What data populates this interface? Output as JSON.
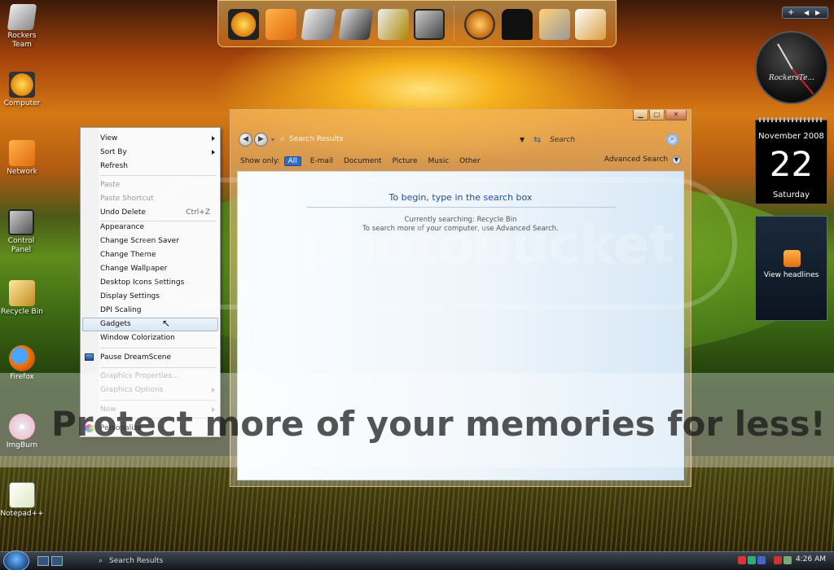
{
  "desktop_icons": [
    {
      "label": "Rockers Team",
      "icon": "rockers-team-icon"
    },
    {
      "label": "Computer",
      "icon": "computer-icon"
    },
    {
      "label": "Network",
      "icon": "network-icon"
    },
    {
      "label": "Control Panel",
      "icon": "control-panel-icon"
    },
    {
      "label": "Recycle Bin",
      "icon": "recycle-bin-icon"
    },
    {
      "label": "Firefox",
      "icon": "firefox-icon"
    },
    {
      "label": "ImgBurn",
      "icon": "imgburn-icon"
    },
    {
      "label": "Notepad++",
      "icon": "notepad-plus-plus-icon"
    }
  ],
  "dock": {
    "items": [
      "computer-icon",
      "network-icon",
      "folder-icon",
      "music-folder-icon",
      "pictures-folder-icon",
      "control-panel-icon",
      "globe-icon",
      "tshirt-icon",
      "tools-icon",
      "documents-icon"
    ]
  },
  "search_window": {
    "breadcrumb": "Search Results",
    "search_placeholder": "Search",
    "show_only_label": "Show only:",
    "filters": [
      "All",
      "E-mail",
      "Document",
      "Picture",
      "Music",
      "Other"
    ],
    "advanced_search_label": "Advanced Search",
    "pane_title": "To begin, type in the search box",
    "pane_line1": "Currently searching: Recycle Bin",
    "pane_line2": "To search more of your computer, use Advanced Search.",
    "controls": {
      "minimize": "▁",
      "maximize": "▢",
      "close": "✕"
    }
  },
  "context_menu": {
    "view": "View",
    "sort_by": "Sort By",
    "refresh": "Refresh",
    "paste": "Paste",
    "paste_shortcut": "Paste Shortcut",
    "undo_delete": "Undo Delete",
    "undo_delete_shortcut": "Ctrl+Z",
    "appearance": "Appearance",
    "change_screen_saver": "Change Screen Saver",
    "change_theme": "Change Theme",
    "change_wallpaper": "Change Wallpaper",
    "desktop_icons_settings": "Desktop Icons Settings",
    "display_settings": "Display Settings",
    "dpi_scaling": "DPI Scaling",
    "gadgets": "Gadgets",
    "window_colorization": "Window Colorization",
    "pause_dreamscene": "Pause DreamScene",
    "graphics_properties": "Graphics Properties...",
    "graphics_options": "Graphics Options",
    "new": "New",
    "personalize": "Personalize"
  },
  "sidebar": {
    "controls": "+",
    "clock_label": "RockersTe...",
    "calendar_month": "November 2008",
    "calendar_day": "22",
    "calendar_weekday": "Saturday",
    "feed_label": "View headlines"
  },
  "watermark": {
    "brand": "photobucket",
    "slogan": "Protect more of your memories for less!"
  },
  "taskbar": {
    "task_label": "Search Results",
    "time": "4:26 AM"
  }
}
